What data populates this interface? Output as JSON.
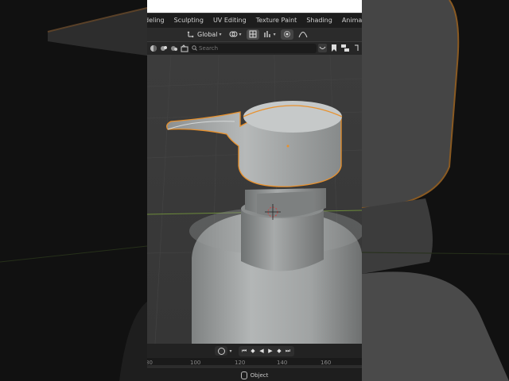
{
  "workspace_tabs": [
    "deling",
    "Sculpting",
    "UV Editing",
    "Texture Paint",
    "Shading",
    "Animati"
  ],
  "header": {
    "orientation_label": "Global",
    "orientation_icon": "transform-orientation-icon",
    "pivot_icon": "pivot-point-icon",
    "snap_icon": "snap-icon",
    "proportional_icon": "proportional-editing-icon"
  },
  "toolbar": {
    "search_placeholder": "Search"
  },
  "timeline": {
    "frame_ticks": [
      "80",
      "100",
      "120",
      "140",
      "160"
    ]
  },
  "status": {
    "label": "Object"
  },
  "colors": {
    "selection_outline": "#e8912d",
    "viewport_bg": "#3a3a3a",
    "axis_green": "#6c8a3a"
  }
}
